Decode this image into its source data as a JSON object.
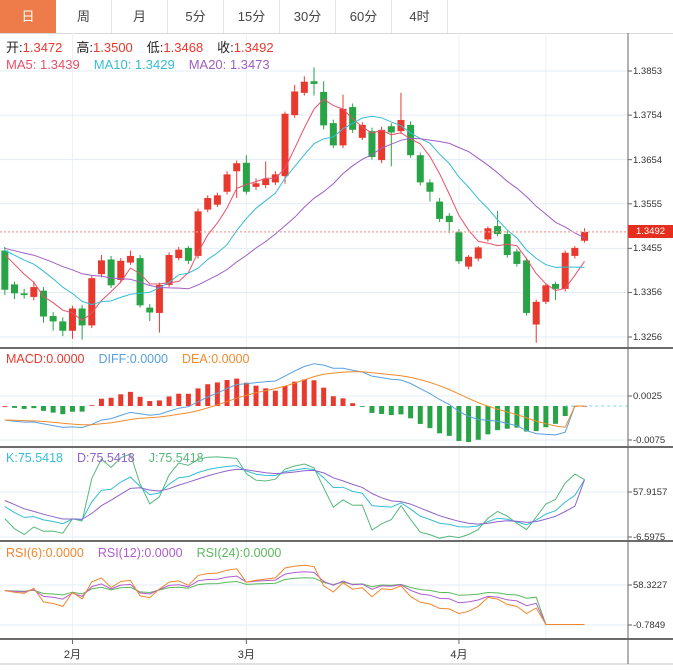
{
  "tabs": {
    "items": [
      {
        "label": "日",
        "active": true
      },
      {
        "label": "周",
        "active": false
      },
      {
        "label": "月",
        "active": false
      },
      {
        "label": "5分",
        "active": false
      },
      {
        "label": "15分",
        "active": false
      },
      {
        "label": "30分",
        "active": false
      },
      {
        "label": "60分",
        "active": false
      },
      {
        "label": "4时",
        "active": false
      }
    ],
    "active_bg": "#ee7c4b"
  },
  "readouts": {
    "ohlc": [
      {
        "label": "开:",
        "value": "1.3472",
        "color": "#e8392f"
      },
      {
        "label": "高:",
        "value": "1.3500",
        "color": "#e8392f"
      },
      {
        "label": "低:",
        "value": "1.3468",
        "color": "#e8392f"
      },
      {
        "label": "收:",
        "value": "1.3492",
        "color": "#e8392f"
      }
    ],
    "ma": [
      {
        "label": "MA5: ",
        "value": "1.3439",
        "color": "#e8506a"
      },
      {
        "label": "MA10: ",
        "value": "1.3429",
        "color": "#35bdd4"
      },
      {
        "label": "MA20: ",
        "value": "1.3473",
        "color": "#a05ec4"
      }
    ],
    "macd": [
      {
        "label": "MACD:",
        "value": "0.0000",
        "color": "#e8392f"
      },
      {
        "label": "DIFF:",
        "value": "0.0000",
        "color": "#5aa0e0"
      },
      {
        "label": "DEA:",
        "value": "0.0000",
        "color": "#f08c2e"
      }
    ],
    "kdj": [
      {
        "label": "K:",
        "value": "75.5418",
        "color": "#35bdd4"
      },
      {
        "label": "D:",
        "value": "75.5418",
        "color": "#8f63c9"
      },
      {
        "label": "J:",
        "value": "75.5418",
        "color": "#56b87b"
      }
    ],
    "rsi": [
      {
        "label": "RSI(6):",
        "value": "0.0000",
        "color": "#f0872e"
      },
      {
        "label": "RSI(12):",
        "value": "0.0000",
        "color": "#b05ecc"
      },
      {
        "label": "RSI(24):",
        "value": "0.0000",
        "color": "#5cb85c"
      }
    ]
  },
  "price_line": {
    "value": "1.3492",
    "badge_color": "#e62e1e",
    "line_color": "#f2a19a"
  },
  "colors": {
    "up": "#e8392e",
    "down": "#28a346",
    "grid": "#e3edf6",
    "vgrid": "#e9f1f7",
    "separator": "#3a3a3a",
    "axis_line": "#666666",
    "ma5": "#e8506a",
    "ma10": "#35bdd4",
    "ma20": "#a05ec4",
    "diff": "#5aa0e0",
    "dea": "#f08c2e",
    "k": "#35bdd4",
    "d": "#8f63c9",
    "j": "#56b87b",
    "rsi6": "#f0872e",
    "rsi12": "#b05ecc",
    "rsi24": "#5cb85c",
    "macd_zero_dash": "#7fd4e8"
  },
  "chart_data": {
    "type": "candlestick",
    "title": "",
    "legend": "up bars red, down bars green (CN convention)",
    "price_axis_range": [
      1.3256,
      1.3853
    ],
    "panels": {
      "price": {
        "y_tick_labels": [
          "1.3853",
          "1.3754",
          "1.3654",
          "1.3555",
          "1.3455",
          "1.3356",
          "1.3256"
        ],
        "last_price_label": "1.3492",
        "ma_periods": [
          5,
          10,
          20
        ],
        "months": [
          {
            "label": "2月",
            "slot": 7
          },
          {
            "label": "3月",
            "slot": 25
          },
          {
            "label": "4月",
            "slot": 47
          }
        ],
        "candles": [
          [
            1.345,
            1.3458,
            1.335,
            1.3362
          ],
          [
            1.3374,
            1.338,
            1.3341,
            1.3354
          ],
          [
            1.3354,
            1.3364,
            1.3342,
            1.335
          ],
          [
            1.3346,
            1.3381,
            1.3338,
            1.3368
          ],
          [
            1.336,
            1.3368,
            1.3288,
            1.3302
          ],
          [
            1.3303,
            1.3312,
            1.327,
            1.3291
          ],
          [
            1.3291,
            1.33,
            1.3258,
            1.327
          ],
          [
            1.327,
            1.3326,
            1.3252,
            1.332
          ],
          [
            1.332,
            1.3328,
            1.325,
            1.3282
          ],
          [
            1.3282,
            1.3394,
            1.3276,
            1.3388
          ],
          [
            1.3397,
            1.344,
            1.339,
            1.3428
          ],
          [
            1.343,
            1.3438,
            1.3366,
            1.3372
          ],
          [
            1.3384,
            1.3433,
            1.3378,
            1.3427
          ],
          [
            1.3423,
            1.345,
            1.3418,
            1.3438
          ],
          [
            1.3433,
            1.344,
            1.3322,
            1.3327
          ],
          [
            1.3322,
            1.333,
            1.3292,
            1.3311
          ],
          [
            1.331,
            1.3378,
            1.3266,
            1.3373
          ],
          [
            1.3373,
            1.3446,
            1.3368,
            1.344
          ],
          [
            1.3433,
            1.3458,
            1.3428,
            1.3452
          ],
          [
            1.3456,
            1.346,
            1.342,
            1.3427
          ],
          [
            1.3438,
            1.3544,
            1.3432,
            1.3538
          ],
          [
            1.3542,
            1.3574,
            1.3536,
            1.3568
          ],
          [
            1.3553,
            1.358,
            1.3548,
            1.3574
          ],
          [
            1.3582,
            1.3628,
            1.3576,
            1.3621
          ],
          [
            1.3628,
            1.3652,
            1.3568,
            1.3646
          ],
          [
            1.3647,
            1.3664,
            1.3576,
            1.3582
          ],
          [
            1.3593,
            1.3612,
            1.3586,
            1.3601
          ],
          [
            1.3597,
            1.365,
            1.359,
            1.3611
          ],
          [
            1.3603,
            1.3628,
            1.3597,
            1.3621
          ],
          [
            1.3617,
            1.3762,
            1.36,
            1.3757
          ],
          [
            1.3754,
            1.3822,
            1.3748,
            1.3807
          ],
          [
            1.3804,
            1.3841,
            1.3798,
            1.3829
          ],
          [
            1.383,
            1.3861,
            1.3798,
            1.3824
          ],
          [
            1.3806,
            1.383,
            1.3722,
            1.3731
          ],
          [
            1.3736,
            1.3744,
            1.368,
            1.3686
          ],
          [
            1.3686,
            1.38,
            1.368,
            1.3768
          ],
          [
            1.3772,
            1.378,
            1.3714,
            1.3721
          ],
          [
            1.3703,
            1.3738,
            1.3698,
            1.3732
          ],
          [
            1.3718,
            1.3726,
            1.3654,
            1.366
          ],
          [
            1.3653,
            1.3728,
            1.3646,
            1.3721
          ],
          [
            1.3729,
            1.3736,
            1.3639,
            1.3715
          ],
          [
            1.3718,
            1.3804,
            1.3712,
            1.3743
          ],
          [
            1.3732,
            1.374,
            1.3658,
            1.3664
          ],
          [
            1.3664,
            1.367,
            1.3596,
            1.3603
          ],
          [
            1.3603,
            1.361,
            1.356,
            1.3582
          ],
          [
            1.356,
            1.3568,
            1.3514,
            1.3521
          ],
          [
            1.3528,
            1.3534,
            1.3489,
            1.3514
          ],
          [
            1.3491,
            1.3498,
            1.342,
            1.3426
          ],
          [
            1.3414,
            1.344,
            1.3408,
            1.3436
          ],
          [
            1.3432,
            1.346,
            1.3426,
            1.3457
          ],
          [
            1.3475,
            1.3504,
            1.347,
            1.35
          ],
          [
            1.3505,
            1.3539,
            1.3482,
            1.3487
          ],
          [
            1.3487,
            1.3494,
            1.3434,
            1.344
          ],
          [
            1.3448,
            1.3454,
            1.3414,
            1.342
          ],
          [
            1.3428,
            1.3434,
            1.3304,
            1.331
          ],
          [
            1.3284,
            1.334,
            1.3243,
            1.3335
          ],
          [
            1.3335,
            1.3376,
            1.333,
            1.3372
          ],
          [
            1.3375,
            1.338,
            1.3339,
            1.3364
          ],
          [
            1.3364,
            1.345,
            1.3358,
            1.3445
          ],
          [
            1.3438,
            1.346,
            1.3432,
            1.3456
          ],
          [
            1.3472,
            1.35,
            1.3468,
            1.3492
          ]
        ]
      },
      "macd": {
        "y_tick_labels": [
          "0.0025",
          "-0.0075"
        ],
        "params": [
          12,
          26,
          9
        ]
      },
      "kdj": {
        "y_tick_labels": [
          "57.9157",
          "-6.5975"
        ],
        "params": [
          9,
          3,
          3
        ]
      },
      "rsi": {
        "y_tick_labels": [
          "58.3227",
          "-0.7849"
        ],
        "params": [
          6,
          12,
          24
        ]
      }
    },
    "tail_overrides": {
      "macd_zero_bars": 2,
      "rsi_zero_bars": 5,
      "kdj_last_value": 75.5418
    }
  }
}
